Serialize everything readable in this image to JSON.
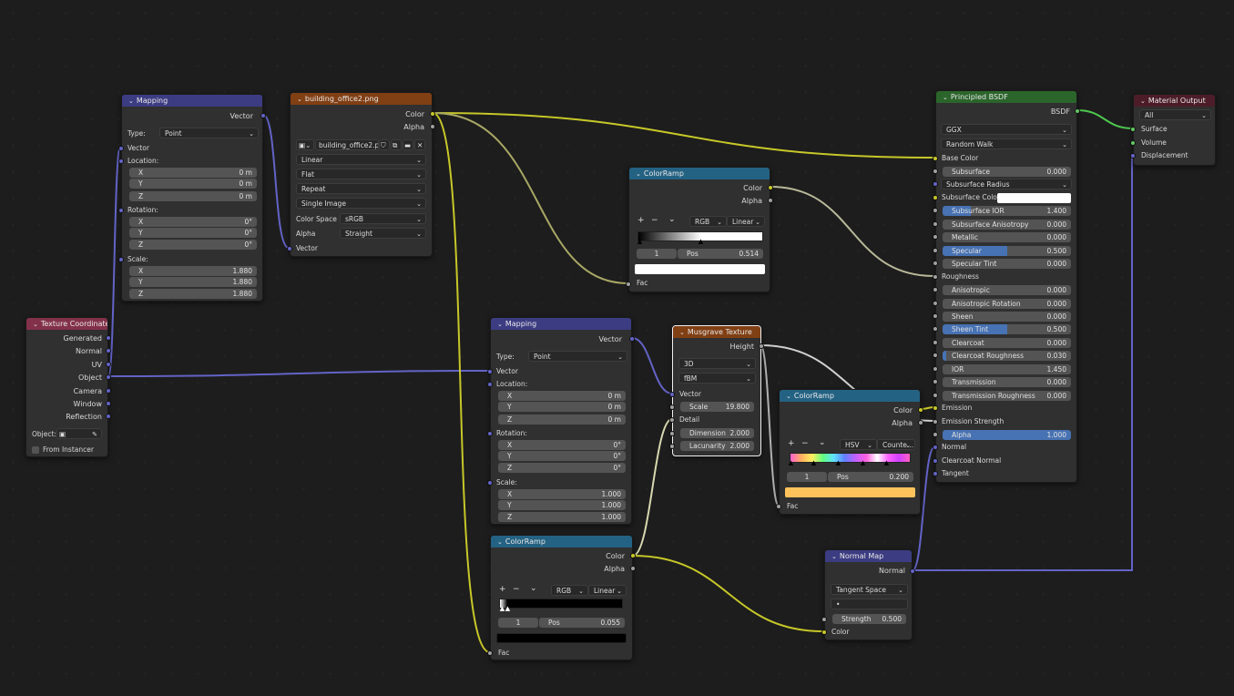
{
  "nodes": {
    "mapping1": {
      "title": "Mapping",
      "output": "Vector",
      "type_label": "Type:",
      "type_value": "Point",
      "input_vector": "Vector",
      "location_label": "Location:",
      "location": [
        {
          "axis": "X",
          "value": "0 m"
        },
        {
          "axis": "Y",
          "value": "0 m"
        },
        {
          "axis": "Z",
          "value": "0 m"
        }
      ],
      "rotation_label": "Rotation:",
      "rotation": [
        {
          "axis": "X",
          "value": "0°"
        },
        {
          "axis": "Y",
          "value": "0°"
        },
        {
          "axis": "Z",
          "value": "0°"
        }
      ],
      "scale_label": "Scale:",
      "scale": [
        {
          "axis": "X",
          "value": "1.880"
        },
        {
          "axis": "Y",
          "value": "1.880"
        },
        {
          "axis": "Z",
          "value": "1.880"
        }
      ]
    },
    "image": {
      "title": "building_office2.png",
      "out_color": "Color",
      "out_alpha": "Alpha",
      "image_name": "building_office2.png",
      "interpolation": "Linear",
      "projection": "Flat",
      "extension": "Repeat",
      "source": "Single Image",
      "colorspace_label": "Color Space",
      "colorspace_value": "sRGB",
      "alpha_label": "Alpha",
      "alpha_value": "Straight",
      "input_vector": "Vector"
    },
    "texcoord": {
      "title": "Texture Coordinate",
      "outputs": [
        "Generated",
        "Normal",
        "UV",
        "Object",
        "Camera",
        "Window",
        "Reflection"
      ],
      "object_label": "Object:",
      "from_instancer": "From Instancer"
    },
    "ramp1": {
      "title": "ColorRamp",
      "out_color": "Color",
      "out_alpha": "Alpha",
      "plus": "+",
      "minus": "−",
      "chev": "⌄",
      "mode": "RGB",
      "interp": "Linear",
      "index": "1",
      "pos_label": "Pos",
      "pos_value": "0.514",
      "input_fac": "Fac",
      "stop_color": "#ffffff"
    },
    "mapping2": {
      "title": "Mapping",
      "output": "Vector",
      "type_label": "Type:",
      "type_value": "Point",
      "input_vector": "Vector",
      "location_label": "Location:",
      "location": [
        {
          "axis": "X",
          "value": "0 m"
        },
        {
          "axis": "Y",
          "value": "0 m"
        },
        {
          "axis": "Z",
          "value": "0 m"
        }
      ],
      "rotation_label": "Rotation:",
      "rotation": [
        {
          "axis": "X",
          "value": "0°"
        },
        {
          "axis": "Y",
          "value": "0°"
        },
        {
          "axis": "Z",
          "value": "0°"
        }
      ],
      "scale_label": "Scale:",
      "scale": [
        {
          "axis": "X",
          "value": "1.000"
        },
        {
          "axis": "Y",
          "value": "1.000"
        },
        {
          "axis": "Z",
          "value": "1.000"
        }
      ]
    },
    "musgrave": {
      "title": "Musgrave Texture",
      "output": "Height",
      "dim_mode": "3D",
      "type_mode": "fBM",
      "input_vector": "Vector",
      "scale_label": "Scale",
      "scale_value": "19.800",
      "detail": "Detail",
      "dimension_label": "Dimension",
      "dimension_value": "2.000",
      "lacunarity_label": "Lacunarity",
      "lacunarity_value": "2.000"
    },
    "ramp2": {
      "title": "ColorRamp",
      "out_color": "Color",
      "out_alpha": "Alpha",
      "plus": "+",
      "minus": "−",
      "chev": "⌄",
      "mode": "HSV",
      "interp": "Counte...",
      "index": "1",
      "pos_label": "Pos",
      "pos_value": "0.200",
      "input_fac": "Fac",
      "stop_color": "#ffc35c"
    },
    "ramp3": {
      "title": "ColorRamp",
      "out_color": "Color",
      "out_alpha": "Alpha",
      "plus": "+",
      "minus": "−",
      "chev": "⌄",
      "mode": "RGB",
      "interp": "Linear",
      "index": "1",
      "pos_label": "Pos",
      "pos_value": "0.055",
      "input_fac": "Fac",
      "stop_color": "#000000"
    },
    "normalmap": {
      "title": "Normal Map",
      "output": "Normal",
      "space": "Tangent Space",
      "uv_value": "•",
      "strength_label": "Strength",
      "strength_value": "0.500",
      "input_color": "Color"
    },
    "bsdf": {
      "title": "Principled BSDF",
      "output": "BSDF",
      "distribution": "GGX",
      "subsurface_method": "Random Walk",
      "base_color": "Base Color",
      "rows": [
        {
          "label": "Subsurface",
          "value": "0.000",
          "fill": 0
        },
        {
          "label": "Subsurface Radius",
          "dropdown": true
        },
        {
          "label": "Subsurface Color",
          "color": "#ffffff"
        },
        {
          "label": "Subsurface IOR",
          "value": "1.400",
          "fill": 0.22
        },
        {
          "label": "Subsurface Anisotropy",
          "value": "0.000",
          "fill": 0
        },
        {
          "label": "Metallic",
          "value": "0.000",
          "fill": 0
        },
        {
          "label": "Specular",
          "value": "0.500",
          "fill": 0.5
        },
        {
          "label": "Specular Tint",
          "value": "0.000",
          "fill": 0
        },
        {
          "label": "Roughness",
          "plain": true
        },
        {
          "label": "Anisotropic",
          "value": "0.000",
          "fill": 0
        },
        {
          "label": "Anisotropic Rotation",
          "value": "0.000",
          "fill": 0
        },
        {
          "label": "Sheen",
          "value": "0.000",
          "fill": 0
        },
        {
          "label": "Sheen Tint",
          "value": "0.500",
          "fill": 0.5
        },
        {
          "label": "Clearcoat",
          "value": "0.000",
          "fill": 0
        },
        {
          "label": "Clearcoat Roughness",
          "value": "0.030",
          "fill": 0.03
        },
        {
          "label": "IOR",
          "value": "1.450",
          "fill": 0
        },
        {
          "label": "Transmission",
          "value": "0.000",
          "fill": 0
        },
        {
          "label": "Transmission Roughness",
          "value": "0.000",
          "fill": 0
        },
        {
          "label": "Emission",
          "plain": true
        },
        {
          "label": "Emission Strength",
          "plain": true
        },
        {
          "label": "Alpha",
          "value": "1.000",
          "fill": 1
        },
        {
          "label": "Normal",
          "plain": true
        },
        {
          "label": "Clearcoat Normal",
          "plain": true
        },
        {
          "label": "Tangent",
          "plain": true
        }
      ]
    },
    "output": {
      "title": "Material Output",
      "target": "All",
      "inputs": [
        "Surface",
        "Volume",
        "Displacement"
      ]
    }
  },
  "colors": {
    "vector_socket": "#6363c7",
    "color_socket": "#c7c729",
    "float_socket": "#a1a1a1",
    "shader_socket": "#63c763",
    "slider_fill": "#4772b3"
  }
}
